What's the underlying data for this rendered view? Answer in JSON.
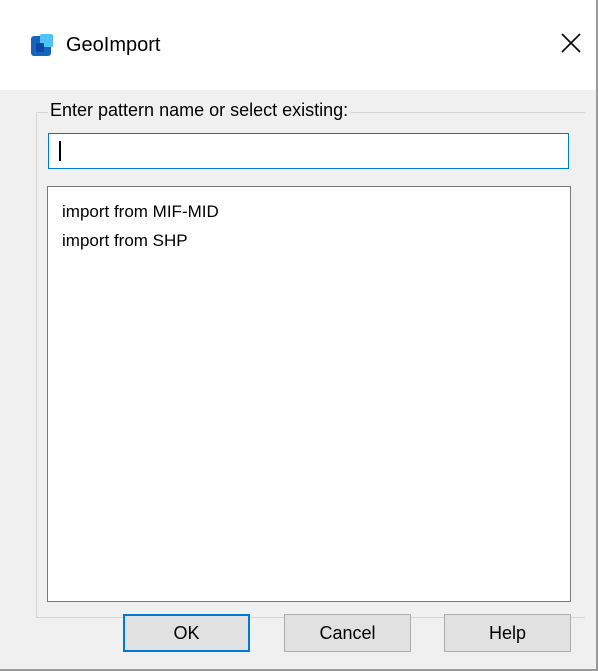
{
  "window": {
    "title": "GeoImport",
    "close_glyph": "✕"
  },
  "icons": {
    "app": "app-icon",
    "close": "close-icon"
  },
  "colors": {
    "accent": "#0078d7",
    "app_icon_dark": "#1565c0",
    "app_icon_light": "#4fc3f7",
    "dialog_bg": "#f0f0f0"
  },
  "form": {
    "label": "Enter pattern name or select existing:",
    "input_value": "",
    "input_placeholder": ""
  },
  "list": {
    "items": [
      {
        "label": "import from MIF-MID"
      },
      {
        "label": "import from SHP"
      }
    ]
  },
  "buttons": {
    "ok": "OK",
    "cancel": "Cancel",
    "help": "Help"
  }
}
